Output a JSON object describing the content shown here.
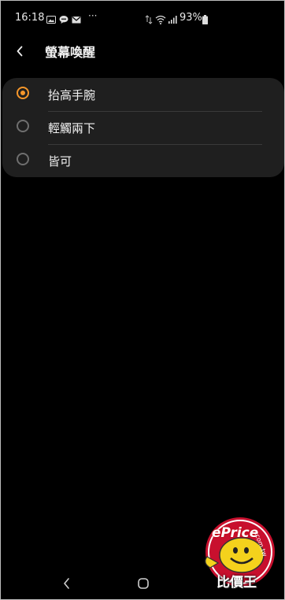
{
  "status_bar": {
    "time": "16:18",
    "battery_percent": "93%",
    "more_indicator": "···"
  },
  "header": {
    "title": "螢幕喚醒"
  },
  "options": [
    {
      "label": "抬高手腕",
      "selected": true
    },
    {
      "label": "輕觸兩下",
      "selected": false
    },
    {
      "label": "皆可",
      "selected": false
    }
  ],
  "watermark": {
    "brand": "ePrice",
    "domain": ".com.tw",
    "sub": "比價王"
  },
  "colors": {
    "accent": "#f5962a",
    "card": "#1f1f1f",
    "background": "#000000"
  },
  "icons": [
    "image-icon",
    "chat-icon",
    "mail-icon",
    "wifi-icon",
    "signal-icon",
    "battery-icon",
    "back-icon",
    "nav-back-icon",
    "nav-home-icon"
  ]
}
